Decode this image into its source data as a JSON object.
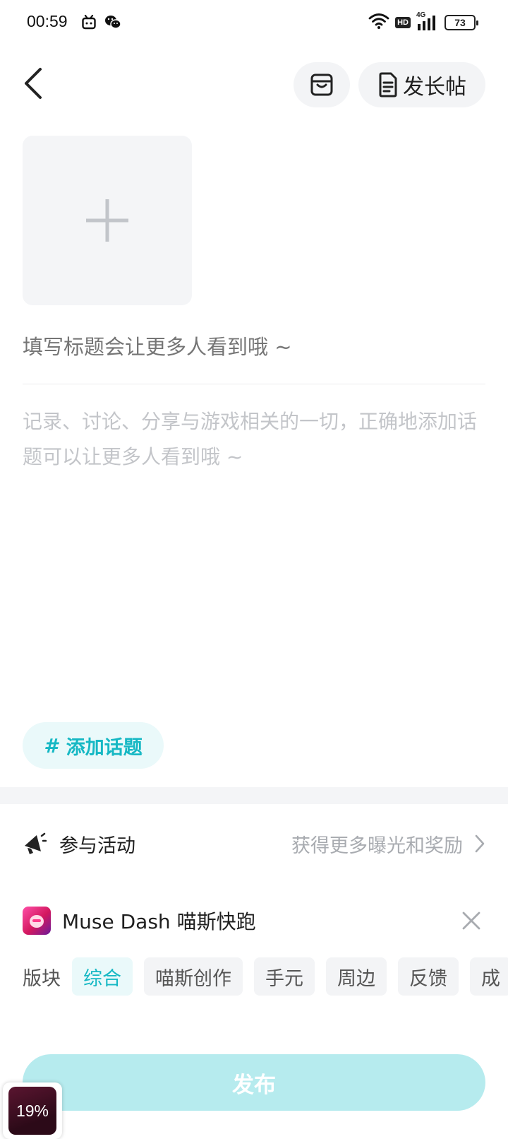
{
  "status_bar": {
    "time": "00:59",
    "hd": "HD",
    "network": "4G",
    "battery": "73"
  },
  "header": {
    "long_post_label": "发长帖"
  },
  "editor": {
    "title_placeholder": "填写标题会让更多人看到哦 ~",
    "body_placeholder": "记录、讨论、分享与游戏相关的一切，正确地添加话题可以让更多人看到哦 ~",
    "add_topic_label": "添加话题",
    "add_topic_symbol": "#"
  },
  "activity": {
    "label": "参与活动",
    "hint": "获得更多曝光和奖励"
  },
  "game": {
    "name": "Muse Dash 喵斯快跑"
  },
  "sections": {
    "label": "版块",
    "chips": [
      "综合",
      "喵斯创作",
      "手元",
      "周边",
      "反馈",
      "成"
    ],
    "selected": "综合"
  },
  "publish": {
    "label": "发布"
  },
  "floating_widget": {
    "value": "19%"
  },
  "colors": {
    "accent": "#16b8c4",
    "accent_light": "#eaf9fa",
    "publish_disabled": "#b6ebee",
    "placeholder": "#b3b6bb"
  }
}
